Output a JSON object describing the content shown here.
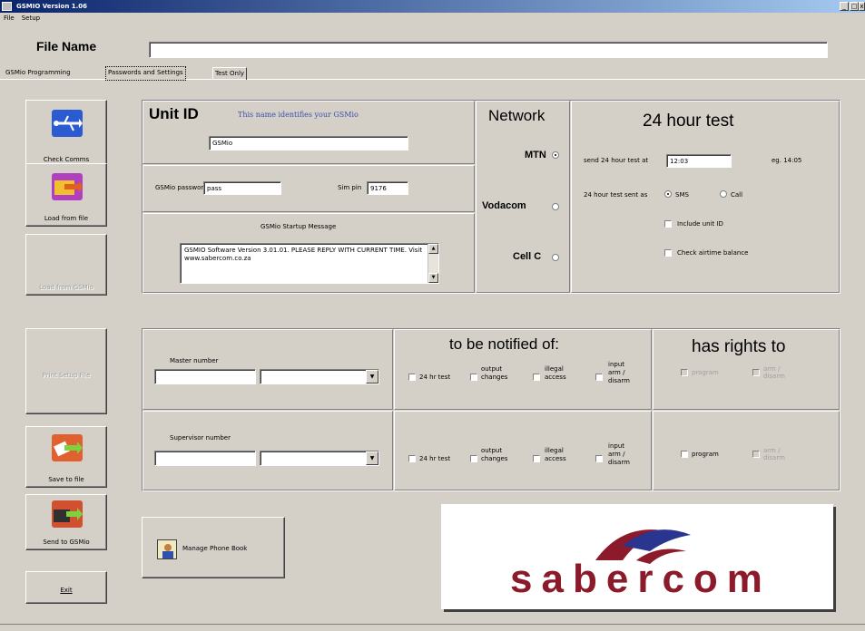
{
  "window": {
    "title": "GSMIO Version 1.06",
    "minimize": "_",
    "restore": "□",
    "close": "x"
  },
  "menu": {
    "file": "File",
    "setup": "Setup"
  },
  "filename": {
    "label": "File Name",
    "value": ""
  },
  "tabs": [
    {
      "label": "GSMio Programming"
    },
    {
      "label": "Passwords and Settings"
    },
    {
      "label": "Test Only"
    }
  ],
  "sidebar": {
    "check_comms": "Check Comms",
    "load_from_file": "Load from file",
    "load_from_gsmio": "Load from GSMio",
    "print_setup_file": "Print Setup File",
    "save_to_file": "Save to file",
    "send_to_gsmio": "Send to GSMio",
    "exit": "Exit"
  },
  "unit": {
    "title": "Unit ID",
    "subtitle": "This name identifies your GSMio",
    "id_value": "GSMio",
    "password_label": "GSMio password",
    "password_value": "pass",
    "sim_pin_label": "Sim pin",
    "sim_pin_value": "9176",
    "startup_label": "GSMio Startup Message",
    "startup_message": "GSMIO Software Version 3.01.01. PLEASE REPLY WITH CURRENT TIME. Visit www.sabercom.co.za"
  },
  "network": {
    "title": "Network",
    "options": [
      "MTN",
      "Vodacom",
      "Cell C"
    ],
    "selected": "MTN"
  },
  "test24": {
    "title": "24 hour test",
    "send_label": "send 24 hour test at",
    "time_value": "12:03",
    "example": "eg. 14:05",
    "sent_as_label": "24 hour test sent as",
    "sms_label": "SMS",
    "call_label": "Call",
    "include_unit_id": "Include unit ID",
    "check_airtime": "Check airtime balance"
  },
  "notify": {
    "title": "to be notified of:",
    "rights_title": "has rights to",
    "master_label": "Master number",
    "supervisor_label": "Supervisor number",
    "opt_24hr": "24 hr test",
    "opt_output": "output changes",
    "opt_illegal": "illegal access",
    "opt_input": "input arm / disarm",
    "right_program": "program",
    "right_arm": "arm / disarm"
  },
  "phonebook": {
    "label": "Manage Phone Book"
  },
  "logo": {
    "text": "sabercom"
  },
  "colors": {
    "title_blue": "#3a4fb0",
    "logo_red": "#8b1a2a",
    "logo_blue": "#2a3590"
  }
}
